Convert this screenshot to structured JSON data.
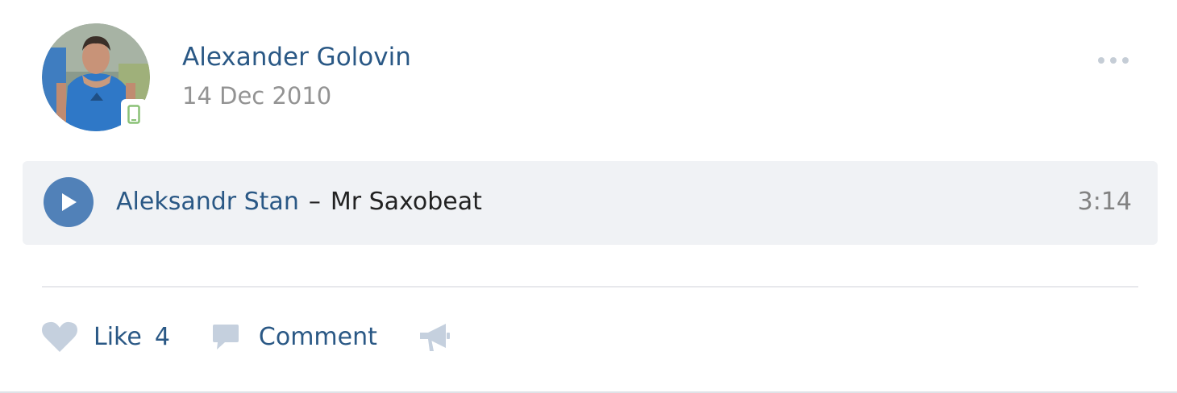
{
  "post": {
    "author_name": "Alexander Golovin",
    "date": "14 Dec 2010",
    "avatar_icon": "user-photo",
    "online_indicator_icon": "mobile-phone-icon",
    "more_icon": "ellipsis-icon"
  },
  "audio": {
    "play_icon": "play-icon",
    "artist": "Aleksandr Stan",
    "separator": "–",
    "title": "Mr Saxobeat",
    "duration": "3:14"
  },
  "actions": {
    "like_label": "Like",
    "like_count": "4",
    "comment_label": "Comment",
    "share_icon": "megaphone-icon"
  },
  "colors": {
    "link": "#2a5885",
    "accent": "#5181b8",
    "audio_bg": "#f0f2f5",
    "muted": "#939393",
    "icon": "#c5d0de",
    "online": "#8ac176"
  }
}
